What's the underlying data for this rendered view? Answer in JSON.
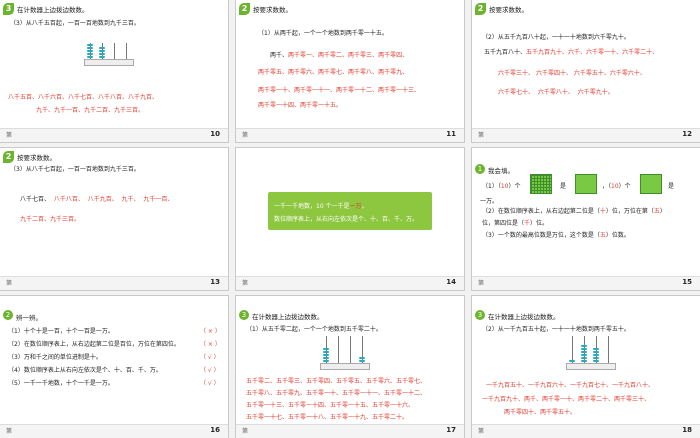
{
  "slide10": {
    "num": "10",
    "footer": "第",
    "title": "在计数器上边拨边数数。",
    "q": "（3）从八千五百起，一百一百地数到九千三百。",
    "bead_labels": [
      "千",
      "百",
      "十",
      "个"
    ],
    "ans1": "八千五百、八千六百、八千七百、八千八百、八千九百、",
    "ans2": "九千、九千一百、九千二百、九千三百。"
  },
  "slide11": {
    "num": "11",
    "footer": "第",
    "badge": "2",
    "title": "按要求数数。",
    "q": "（1）从两千起，一个一个地数到两千零一十五。",
    "l1": [
      "两千、",
      "两千零一、",
      "两千零二、",
      "两千零三、",
      "两千零四、"
    ],
    "l2": [
      "两千零五、",
      "两千零六、",
      "两千零七、",
      "两千零八、",
      "两千零九、"
    ],
    "l3": [
      "两千零一十、",
      "两千零一十一、",
      "两千零一十二、",
      "两千零一十三、"
    ],
    "l4": "两千零一十四、两千零一十五。"
  },
  "slide12": {
    "num": "12",
    "footer": "第",
    "badge": "2",
    "title": "按要求数数。",
    "q": "（2）从五千九百八十起，一十一十地数到六千零九十。",
    "l1": [
      "五千九百八十、",
      "五千九百九十、",
      "六千、",
      "六千零一十、",
      "六千零二十、"
    ],
    "l2": [
      "六千零三十、",
      "六千零四十、",
      "六千零五十、",
      "六千零六十、"
    ],
    "l3": [
      "六千零七十、",
      "六千零八十、",
      "六千零九十。"
    ]
  },
  "slide13": {
    "num": "13",
    "footer": "第",
    "badge": "2",
    "title": "按要求数数。",
    "q": "（3）从八千七百起，一百一百地数到九千三百。",
    "l1": [
      "八千七百、",
      "八千八百、",
      "八千九百、",
      "九千、",
      "九千一百、"
    ],
    "l2": "九千二百、九千三百。"
  },
  "slide14": {
    "num": "14",
    "footer": "第",
    "line1a": "一千一千地数，10 个一千是",
    "line1b": "一万",
    "line1c": "。",
    "line2": "数位顺序表上，从右向左依次是个、十、百、千、万。"
  },
  "slide15": {
    "num": "15",
    "footer": "第",
    "badge": "1",
    "title": "我会填。",
    "q1a": "（1）（",
    "q1n1": "10",
    "q1b": "）个",
    "q1c": "是",
    "q1d": "，（",
    "q1n2": "10",
    "q1e": "）个",
    "q1f": "是",
    "q1g": "一万。",
    "q2a": "（2）在数位顺序表上，从右边起第二位是（",
    "q2n1": "十",
    "q2b": "）位，万位在第（",
    "q2n2": "五",
    "q2c": "）",
    "q2d": "位，第四位是（",
    "q2n3": "千",
    "q2e": "）位。",
    "q3a": "（3）一个数的最高位数是万位，这个数是（",
    "q3n": "五",
    "q3b": "）位数。"
  },
  "slide16": {
    "num": "16",
    "footer": "第",
    "title": "辨一辨。",
    "items": [
      {
        "t": "（1）十个十是一百，十个一百是一万。",
        "a": "（ × ）"
      },
      {
        "t": "（2）在数位顺序表上，从右边起第二位是百位，万位在第四位。",
        "a": "（ × ）"
      },
      {
        "t": "（3）万和千之间的单位进制是十。",
        "a": "（ √ ）"
      },
      {
        "t": "（4）数位顺序表上从右向左依次是个、十、百、千、万。",
        "a": "（ √ ）"
      },
      {
        "t": "（5）一千一千地数，十个一千是一万。",
        "a": "（ √ ）"
      }
    ]
  },
  "slide17": {
    "num": "17",
    "footer": "第",
    "badge": "3",
    "title": "在计数器上边拨边数数。",
    "q": "（1）从五千零二起，一个一个地数到五千零二十。",
    "bead_labels": [
      "千",
      "百",
      "十",
      "个"
    ],
    "l1": "五千零二、五千零三、五千零四、五千零五、五千零六、五千零七、",
    "l2": "五千零八、五千零九、五千零一十、五千零一十一、五千零一十二、",
    "l3": "五千零一十三、五千零一十四、五千零一十五、五千零一十六、",
    "l4": "五千零一十七、五千零一十八、五千零一十九、五千零二十。"
  },
  "slide18": {
    "num": "18",
    "footer": "第",
    "title": "在计数器上边拨边数数。",
    "q": "（2）从一千九百五十起，一十一十地数到两千零五十。",
    "bead_labels": [
      "千",
      "百",
      "十",
      "个"
    ],
    "l1": "一千九百五十、一千九百六十、一千九百七十、一千九百八十、",
    "l2": "一千九百九十、两千、两千零一十、两千零二十、两千零三十、",
    "l3": "两千零四十、两千零五十。"
  }
}
